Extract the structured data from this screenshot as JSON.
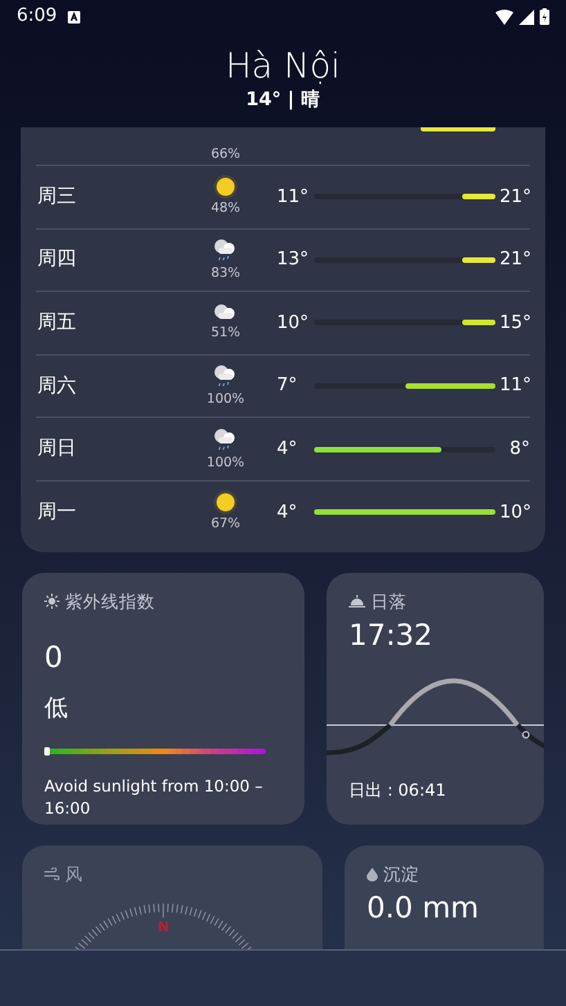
{
  "status_bar": {
    "time": "6:09"
  },
  "header": {
    "city": "Hà Nội",
    "summary": "14° | 晴"
  },
  "forecast": {
    "partial_row": {
      "precip": "66%"
    },
    "rows": [
      {
        "day": "周三",
        "kind": "sun",
        "precip": "48%",
        "low": "11°",
        "high": "21°",
        "level": 0.18,
        "color": "#e8e838"
      },
      {
        "day": "周四",
        "kind": "rain",
        "precip": "83%",
        "low": "13°",
        "high": "21°",
        "level": 0.18,
        "color": "#e8e838"
      },
      {
        "day": "周五",
        "kind": "cloud",
        "precip": "51%",
        "low": "10°",
        "high": "15°",
        "level": 0.18,
        "color": "#cfe82e"
      },
      {
        "day": "周六",
        "kind": "rain",
        "precip": "100%",
        "low": "7°",
        "high": "11°",
        "level": 0.5,
        "color": "#a8e030"
      },
      {
        "day": "周日",
        "kind": "rain",
        "precip": "100%",
        "low": "4°",
        "high": "8°",
        "level": 0.7,
        "color": "#8ee03a"
      },
      {
        "day": "周一",
        "kind": "sun",
        "precip": "67%",
        "low": "4°",
        "high": "10°",
        "level": 1,
        "color": "#96e03a"
      }
    ]
  },
  "uv": {
    "title": "紫外线指数",
    "value": "0",
    "category": "低",
    "level": 0,
    "advice": "Avoid sunlight from 10:00 – 16:00"
  },
  "sunset": {
    "title": "日落",
    "time": "17:32",
    "sunrise": "日出 : 06:41"
  },
  "wind": {
    "title": "风",
    "compass_label": "N"
  },
  "precipitation": {
    "title": "沉淀",
    "value": "0.0 mm"
  }
}
